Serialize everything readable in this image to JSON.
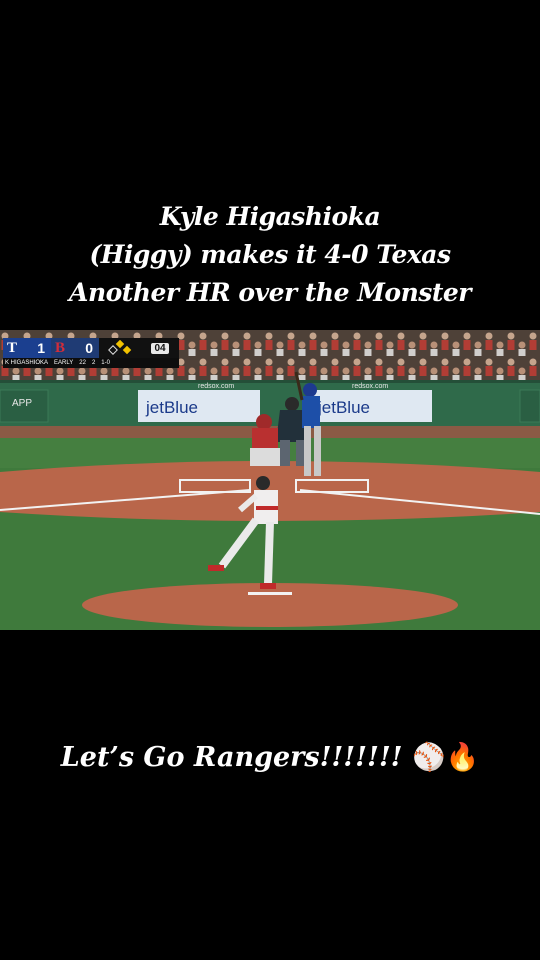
{
  "caption": {
    "lines": [
      "Kyle Higashioka",
      "(Higgy) makes it 4-0 Texas",
      "Another HR over the Monster"
    ],
    "footer": "Let’s Go Rangers!!!!!!!",
    "footer_emojis": [
      "baseball-emoji",
      "fire-emoji"
    ]
  },
  "scorebug": {
    "away_logo": "T",
    "away_score": "1",
    "home_logo": "B",
    "home_score": "0",
    "inning": "04",
    "batter_line": "K HIGASHIOKA",
    "count": "1-0",
    "outs": "2",
    "pitcher_line": "EARLY",
    "pitch_count": "22"
  },
  "signage": {
    "left_url": "redsox.com",
    "right_url": "redsox.com",
    "wall_app": "APP",
    "ad_left": "jetBlue",
    "ad_right": "jetBlue"
  },
  "colors": {
    "background": "#000000",
    "caption_text": "#ffffff",
    "wall_green": "#2f6a4a",
    "grass": "#3f7a3c",
    "dirt": "#b9664a"
  }
}
